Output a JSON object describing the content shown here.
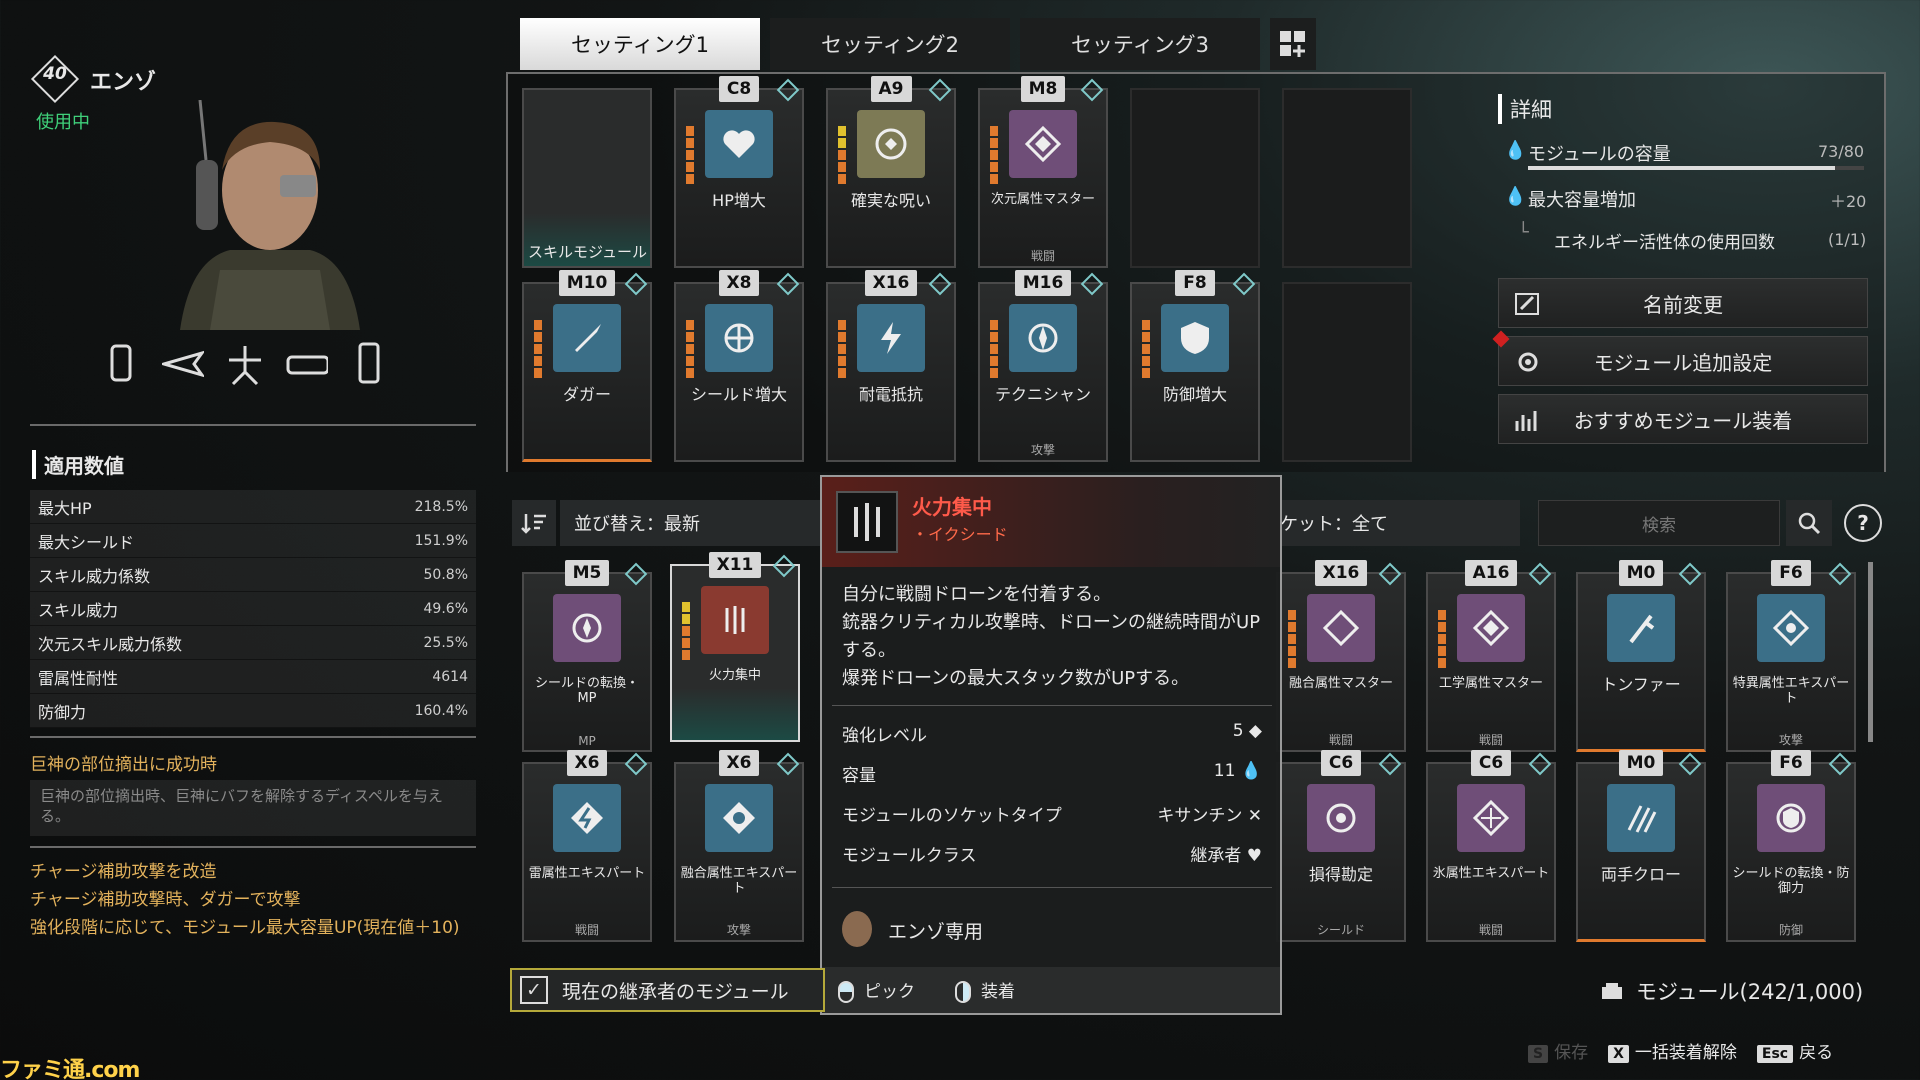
{
  "character": {
    "level": "40",
    "name": "エンゾ",
    "status": "使用中"
  },
  "tabs": [
    "セッティング1",
    "セッティング2",
    "セッティング3"
  ],
  "stats": {
    "title": "適用数値",
    "rows": [
      {
        "label": "最大HP",
        "value": "218.5%"
      },
      {
        "label": "最大シールド",
        "value": "151.9%"
      },
      {
        "label": "スキル威力係数",
        "value": "50.8%"
      },
      {
        "label": "スキル威力",
        "value": "49.6%"
      },
      {
        "label": "次元スキル威力係数",
        "value": "25.5%"
      },
      {
        "label": "雷属性耐性",
        "value": "4614"
      },
      {
        "label": "防御力",
        "value": "160.4%"
      }
    ]
  },
  "skill_desc": {
    "title": "巨神の部位摘出に成功時",
    "body": "巨神の部位摘出時、巨神にバフを解除するディスペルを与える。",
    "extra_lines": [
      "チャージ補助攻撃を改造",
      "チャージ補助攻撃時、ダガーで攻撃",
      "強化段階に応じて、モジュール最大容量UP(現在値＋10)"
    ]
  },
  "equipped": {
    "skill_slot_label": "スキルモジュール",
    "row1": [
      {
        "badge": "C8",
        "name": "HP増大",
        "cat": "",
        "color": "#3b6f88"
      },
      {
        "badge": "A9",
        "name": "確実な呪い",
        "cat": "",
        "color": "#7d7a55"
      },
      {
        "badge": "M8",
        "name": "次元属性マスター",
        "cat": "戦闘",
        "color": "#6f4e78"
      }
    ],
    "row2": [
      {
        "badge": "M10",
        "name": "ダガー",
        "cat": "",
        "color": "#3b6f88"
      },
      {
        "badge": "X8",
        "name": "シールド増大",
        "cat": "",
        "color": "#3b6f88"
      },
      {
        "badge": "X16",
        "name": "耐電抵抗",
        "cat": "",
        "color": "#3b6f88"
      },
      {
        "badge": "M16",
        "name": "テクニシャン",
        "cat": "攻撃",
        "color": "#3b6f88"
      },
      {
        "badge": "F8",
        "name": "防御増大",
        "cat": "",
        "color": "#3b6f88"
      }
    ]
  },
  "detail": {
    "title": "詳細",
    "capacity_label": "モジュールの容量",
    "capacity_value": "73/80",
    "capacity_fraction": 0.9125,
    "max_label": "最大容量増加",
    "max_value": "＋20",
    "energy_label": "エネルギー活性体の使用回数",
    "energy_value": "(1/1)",
    "buttons": [
      "名前変更",
      "モジュール追加設定",
      "おすすめモジュール装着"
    ]
  },
  "sort": {
    "label": "並び替え：最新",
    "socket": "ケット：全て",
    "search_placeholder": "検索",
    "help": "?"
  },
  "inventory": {
    "row1_left": [
      {
        "badge": "M5",
        "name": "シールドの転換・MP",
        "cat": "MP",
        "color": "#6f4e78"
      },
      {
        "badge": "X11",
        "name": "火力集中",
        "cat": "",
        "color": "#8a3a30"
      }
    ],
    "row1_right": [
      {
        "badge": "X16",
        "name": "融合属性マスター",
        "cat": "戦闘",
        "color": "#6f4e78"
      },
      {
        "badge": "A16",
        "name": "工学属性マスター",
        "cat": "戦闘",
        "color": "#6f4e78"
      },
      {
        "badge": "M0",
        "name": "トンファー",
        "cat": "",
        "color": "#3b6f88"
      },
      {
        "badge": "F6",
        "name": "特異属性エキスパート",
        "cat": "攻撃",
        "color": "#3b6f88"
      }
    ],
    "row2_left": [
      {
        "badge": "X6",
        "name": "雷属性エキスパート",
        "cat": "戦闘",
        "color": "#3b6f88"
      },
      {
        "badge": "X6",
        "name": "融合属性エキスパート",
        "cat": "攻撃",
        "color": "#3b6f88"
      }
    ],
    "row2_right": [
      {
        "badge": "C6",
        "name": "損得勘定",
        "cat": "シールド",
        "color": "#6f4e78"
      },
      {
        "badge": "C6",
        "name": "氷属性エキスパート",
        "cat": "戦闘",
        "color": "#6f4e78"
      },
      {
        "badge": "M0",
        "name": "両手クロー",
        "cat": "",
        "color": "#3b6f88"
      },
      {
        "badge": "F6",
        "name": "シールドの転換・防御力",
        "cat": "防御",
        "color": "#6f4e78"
      }
    ]
  },
  "tooltip": {
    "name": "火力集中",
    "sub": "・イクシード",
    "desc": "自分に戦闘ドローンを付着する。\n銃器クリティカル攻撃時、ドローンの継続時間がUPする。\n爆発ドローンの最大スタック数がUPする。",
    "props": [
      {
        "label": "強化レベル",
        "value": "5"
      },
      {
        "label": "容量",
        "value": "11"
      },
      {
        "label": "モジュールのソケットタイプ",
        "value": "キサンチン"
      },
      {
        "label": "モジュールクラス",
        "value": "継承者"
      }
    ],
    "exclusive": "エンゾ専用",
    "actions": [
      "ピック",
      "装着"
    ]
  },
  "footer": {
    "checkbox_label": "現在の継承者のモジュール",
    "module_count": "モジュール(242/1,000)",
    "hints": [
      {
        "key": "S",
        "label": "保存"
      },
      {
        "key": "X",
        "label": "一括装着解除"
      },
      {
        "key": "Esc",
        "label": "戻る"
      }
    ]
  },
  "watermark": "ファミ通.com"
}
